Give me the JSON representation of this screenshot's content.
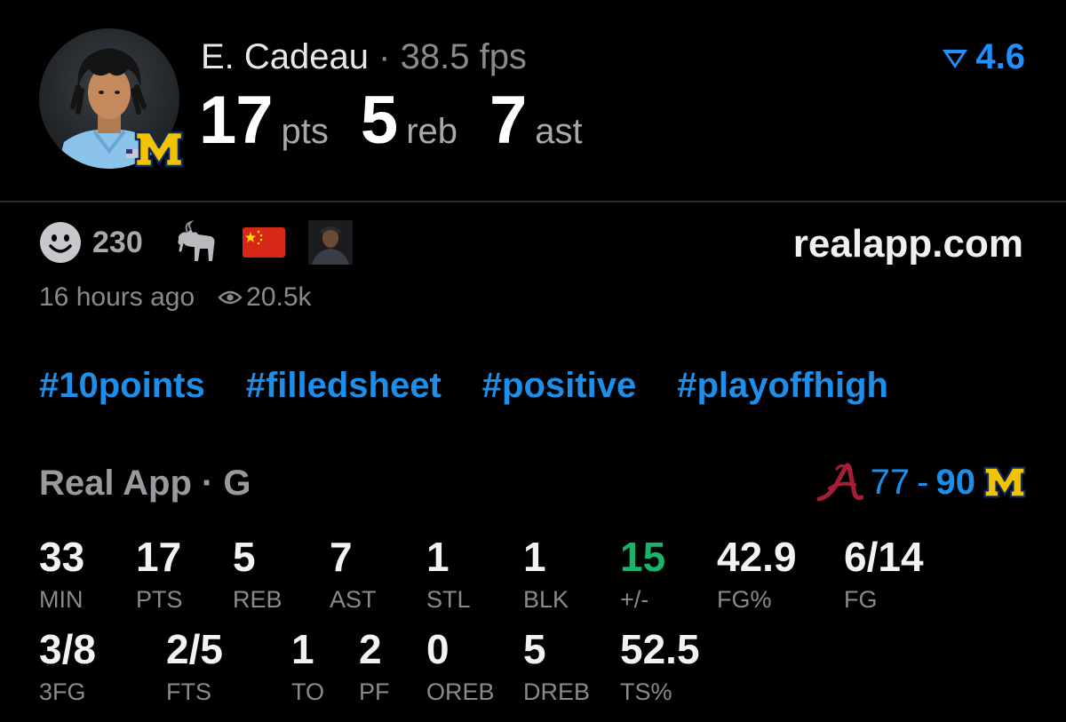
{
  "player": {
    "name": "E. Cadeau",
    "separator": "·",
    "fps": "38.5 fps",
    "pts": "17",
    "pts_label": "pts",
    "reb": "5",
    "reb_label": "reb",
    "ast": "7",
    "ast_label": "ast",
    "rating": "4.6"
  },
  "reactions": {
    "count": "230",
    "icons": [
      "smiley-icon",
      "goat-icon",
      "china-flag-icon",
      "user-avatar-icon"
    ]
  },
  "site": "realapp.com",
  "meta": {
    "time": "16 hours ago",
    "views": "20.5k"
  },
  "tags": [
    "#10points",
    "#filledsheet",
    "#positive",
    "#playoffhigh"
  ],
  "game": {
    "label": "Real App · G",
    "away_score": "77",
    "dash": "-",
    "home_score": "90"
  },
  "box_score": {
    "row1": [
      {
        "value": "33",
        "label": "MIN"
      },
      {
        "value": "17",
        "label": "PTS"
      },
      {
        "value": "5",
        "label": "REB"
      },
      {
        "value": "7",
        "label": "AST"
      },
      {
        "value": "1",
        "label": "STL"
      },
      {
        "value": "1",
        "label": "BLK"
      },
      {
        "value": "15",
        "label": "+/-"
      },
      {
        "value": "42.9",
        "label": "FG%"
      },
      {
        "value": "6/14",
        "label": "FG"
      }
    ],
    "row2": [
      {
        "value": "3/8",
        "label": "3FG"
      },
      {
        "value": "2/5",
        "label": "FTS"
      },
      {
        "value": "1",
        "label": "TO"
      },
      {
        "value": "2",
        "label": "PF"
      },
      {
        "value": "0",
        "label": "OREB"
      },
      {
        "value": "5",
        "label": "DREB"
      },
      {
        "value": "52.5",
        "label": "TS%"
      }
    ]
  },
  "colors": {
    "accent_blue": "#1e8ee8",
    "positive_green": "#19b46a",
    "michigan_maize": "#f2c300",
    "michigan_blue": "#0b2a5b",
    "alabama_crimson": "#a51e36"
  }
}
